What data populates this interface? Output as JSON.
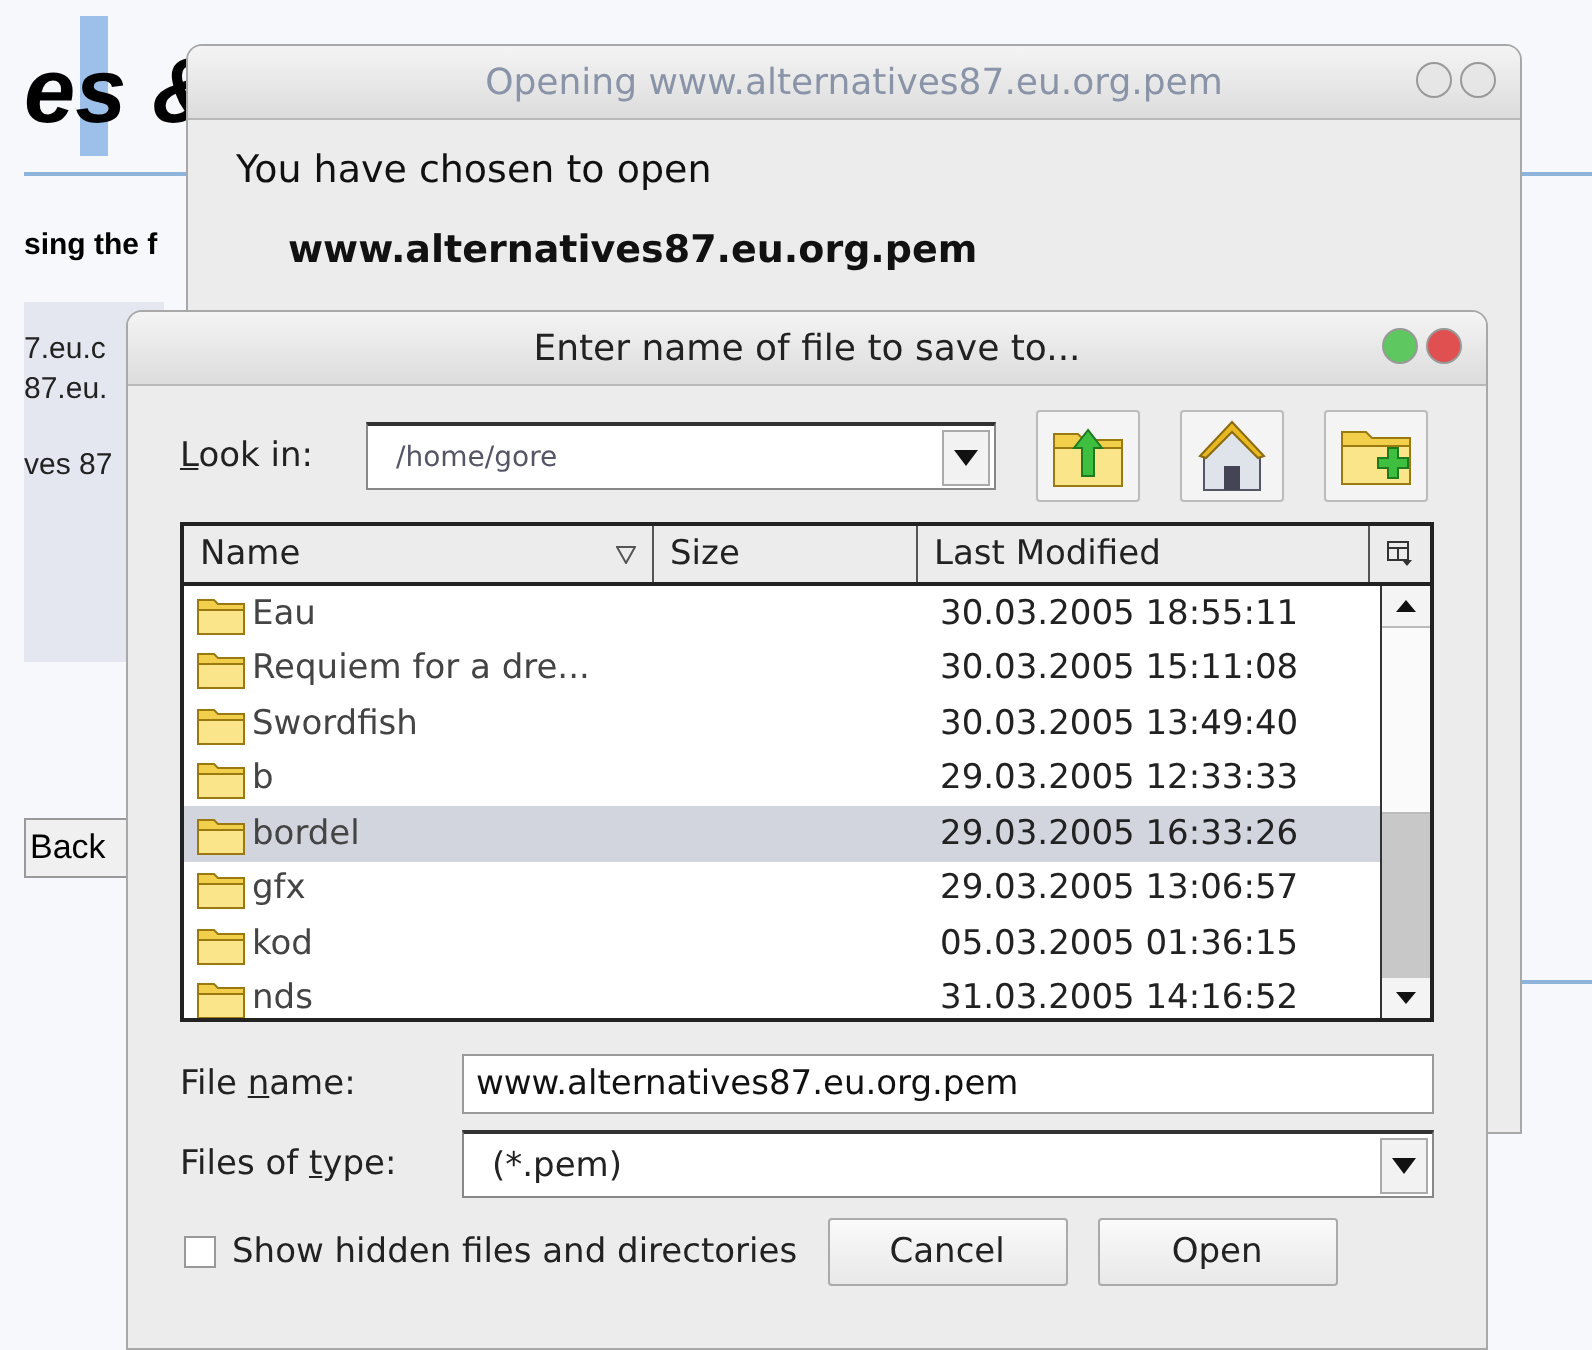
{
  "background_page": {
    "heading": "es &",
    "subheading": "sing the f",
    "side_lines": [
      "7.eu.c",
      "87.eu.",
      "ves 87"
    ],
    "back_button": "Back"
  },
  "open_dialog": {
    "title": "Opening www.alternatives87.eu.org.pem",
    "active": false,
    "prompt": "You have chosen to open",
    "file_name": "www.alternatives87.eu.org.pem"
  },
  "save_dialog": {
    "title": "Enter name of file to save to...",
    "active": true,
    "look_in": {
      "label_parts": [
        {
          "text": "L",
          "underline": true
        },
        {
          "text": "ook in:",
          "underline": false
        }
      ],
      "value": "/home/gore"
    },
    "toolbar": [
      {
        "kind": "up"
      },
      {
        "kind": "home"
      },
      {
        "kind": "new-folder"
      }
    ],
    "table": {
      "columns": [
        {
          "label": "Name",
          "sorted": true
        },
        {
          "label": "Size",
          "sorted": false
        },
        {
          "label": "Last Modified",
          "sorted": false
        }
      ],
      "rows": [
        {
          "name": "Eau",
          "modified": "30.03.2005 18:55:11",
          "selected": false
        },
        {
          "name": "Requiem for a dre...",
          "modified": "30.03.2005 15:11:08",
          "selected": false
        },
        {
          "name": "Swordfish",
          "modified": "30.03.2005 13:49:40",
          "selected": false
        },
        {
          "name": "b",
          "modified": "29.03.2005 12:33:33",
          "selected": false
        },
        {
          "name": "bordel",
          "modified": "29.03.2005 16:33:26",
          "selected": true
        },
        {
          "name": "gfx",
          "modified": "29.03.2005 13:06:57",
          "selected": false
        },
        {
          "name": "kod",
          "modified": "05.03.2005 01:36:15",
          "selected": false
        },
        {
          "name": "nds",
          "modified": "31.03.2005 14:16:52",
          "selected": false
        }
      ]
    },
    "file_name": {
      "label_parts": [
        {
          "text": "File ",
          "underline": false
        },
        {
          "text": "n",
          "underline": true
        },
        {
          "text": "ame:",
          "underline": false
        }
      ],
      "value": "www.alternatives87.eu.org.pem"
    },
    "file_type": {
      "label_parts": [
        {
          "text": "Files of ",
          "underline": false
        },
        {
          "text": "t",
          "underline": true
        },
        {
          "text": "ype:",
          "underline": false
        }
      ],
      "value": "(*.pem)"
    },
    "show_hidden": {
      "label": "Show hidden files and directories",
      "checked": false
    },
    "buttons": [
      "Cancel",
      "Open"
    ]
  }
}
